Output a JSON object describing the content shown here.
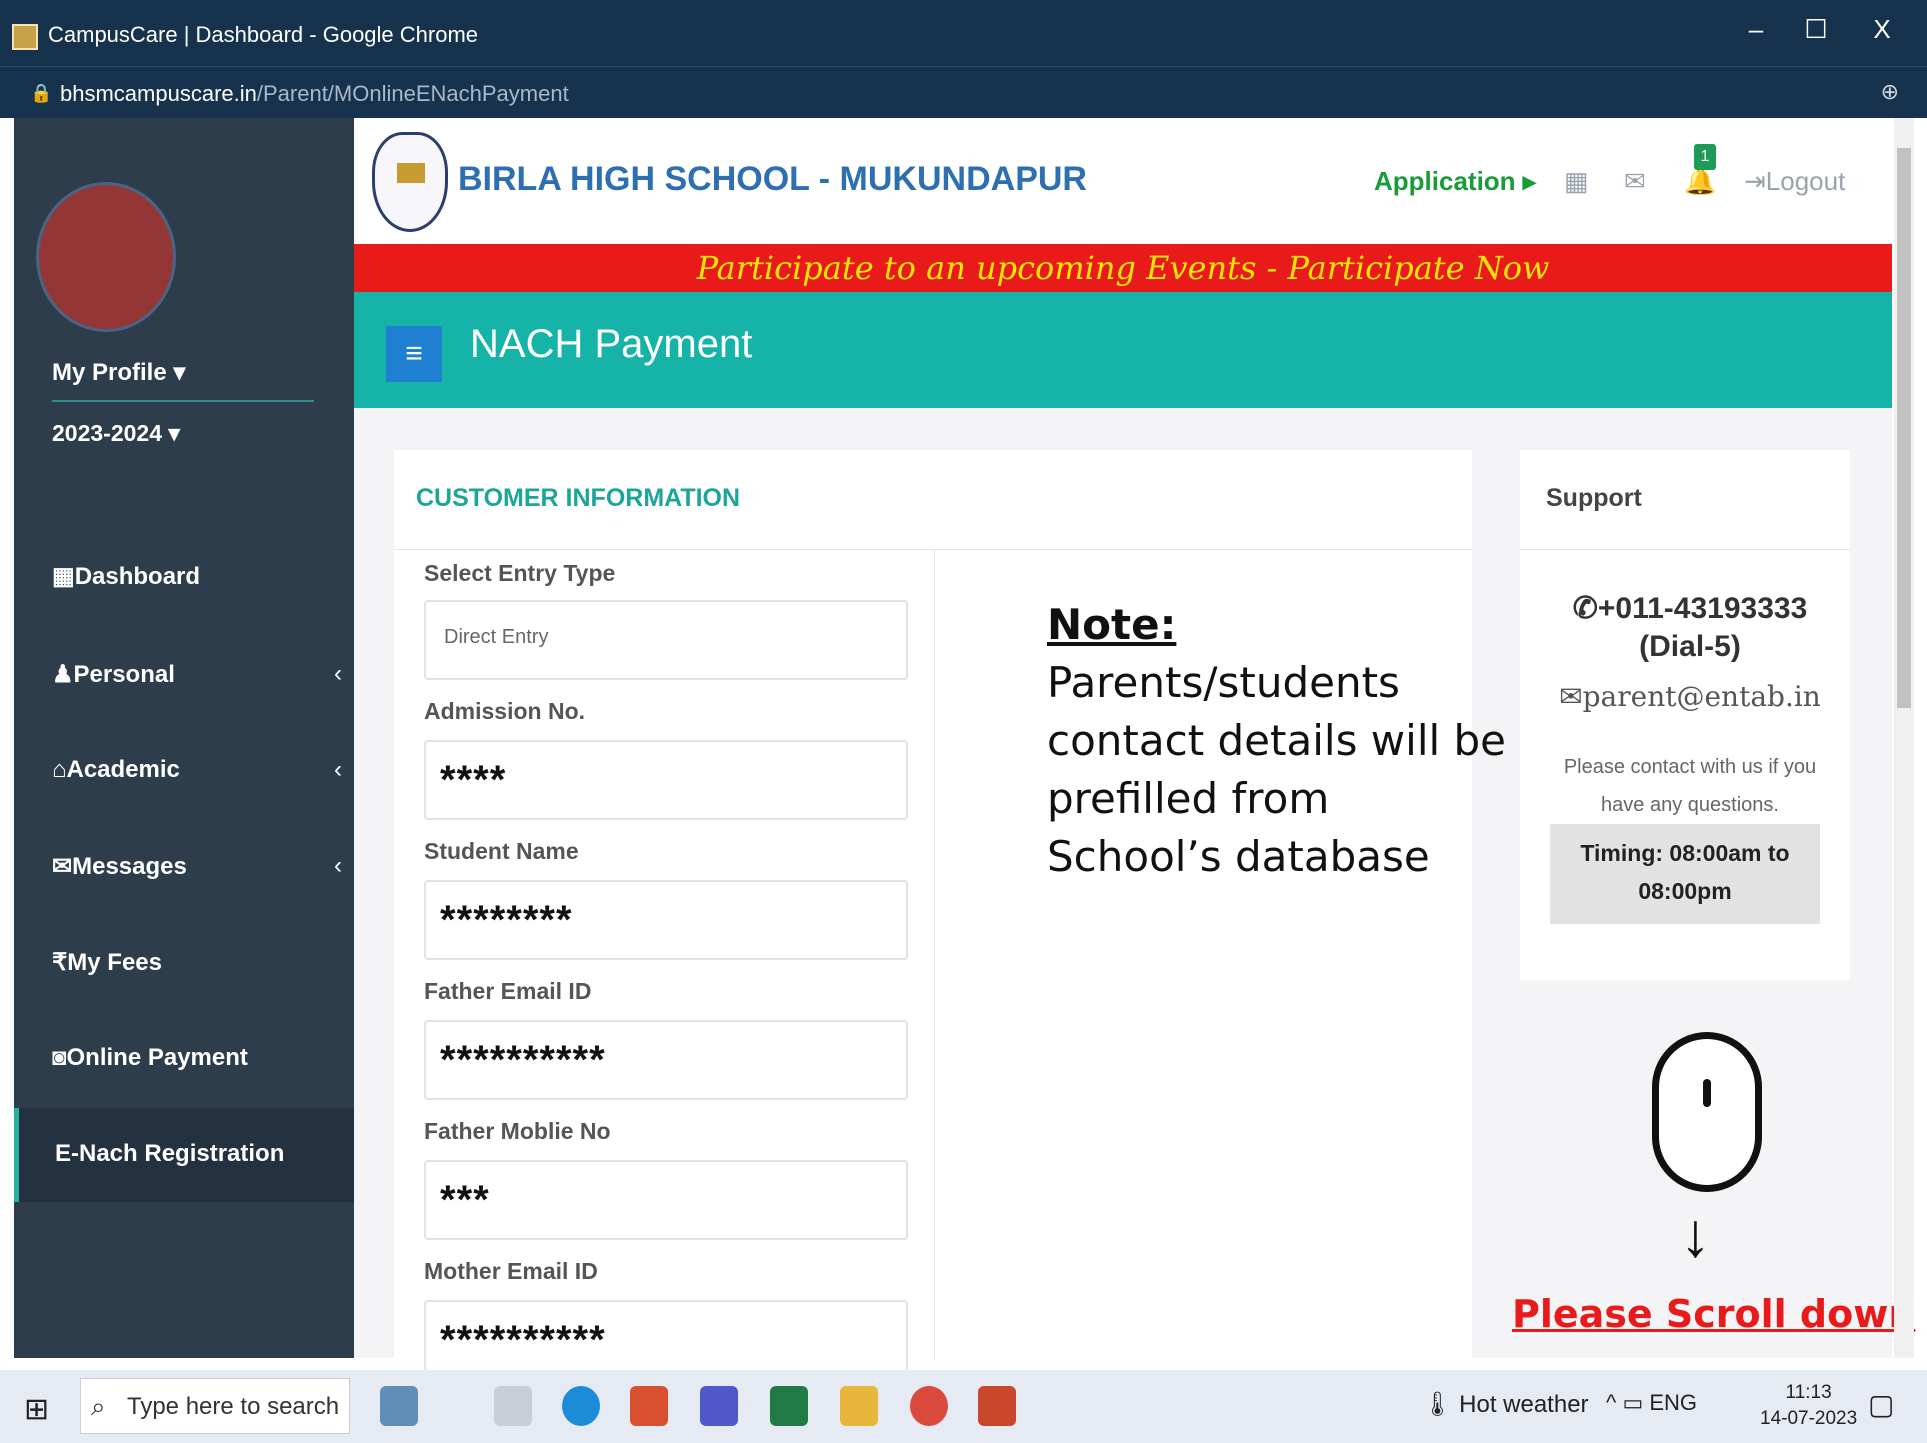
{
  "browser": {
    "window_title": "CampusCare | Dashboard - Google Chrome",
    "url_domain": "bhsmcampuscare.in",
    "url_path": "/Parent/MOnlineENachPayment",
    "minimize": "–",
    "maximize": "☐",
    "close": "X"
  },
  "sidebar": {
    "profile_label": "My Profile ▾",
    "session": "2023-2024 ▾",
    "items": [
      {
        "icon": "▦",
        "label": "Dashboard",
        "chevron": ""
      },
      {
        "icon": "♟",
        "label": "Personal",
        "chevron": "‹"
      },
      {
        "icon": "⌂",
        "label": "Academic",
        "chevron": "‹"
      },
      {
        "icon": "✉",
        "label": "Messages",
        "chevron": "‹"
      },
      {
        "icon": "₹",
        "label": "My Fees",
        "chevron": ""
      },
      {
        "icon": "◙",
        "label": "Online Payment",
        "chevron": ""
      }
    ],
    "active_item": "E-Nach Registration"
  },
  "header": {
    "school_name": "BIRLA HIGH SCHOOL - MUKUNDAPUR",
    "application_menu": "Application ▸",
    "notification_count": "1",
    "logout": "Logout"
  },
  "banner": {
    "text": "Participate to an upcoming Events - Participate Now"
  },
  "page": {
    "title": "NACH Payment",
    "menu_glyph": "≡"
  },
  "form": {
    "section_title": "CUSTOMER INFORMATION",
    "fields": [
      {
        "label": "Select Entry Type",
        "value": "Direct Entry"
      },
      {
        "label": "Admission No.",
        "value": "****"
      },
      {
        "label": "Student Name",
        "value": "********"
      },
      {
        "label": "Father Email ID",
        "value": "**********"
      },
      {
        "label": "Father Moblie No",
        "value": "***"
      },
      {
        "label": "Mother Email ID",
        "value": "**********"
      }
    ]
  },
  "note": {
    "title": "Note:",
    "lines": [
      "Parents/students",
      "contact details will be",
      "prefilled from",
      "School’s database"
    ]
  },
  "support": {
    "title": "Support",
    "phone": "+011-43193333 (Dial-5)",
    "email": "parent@entab.in",
    "help": "Please contact with us if you have any questions.",
    "timing": "Timing: 08:00am to 08:00pm"
  },
  "scroll_hint": {
    "text": "Please Scroll down"
  },
  "taskbar": {
    "search_placeholder": "Type here to search",
    "weather": "Hot weather",
    "language": "ENG",
    "time": "11:13",
    "date": "14-07-2023"
  }
}
